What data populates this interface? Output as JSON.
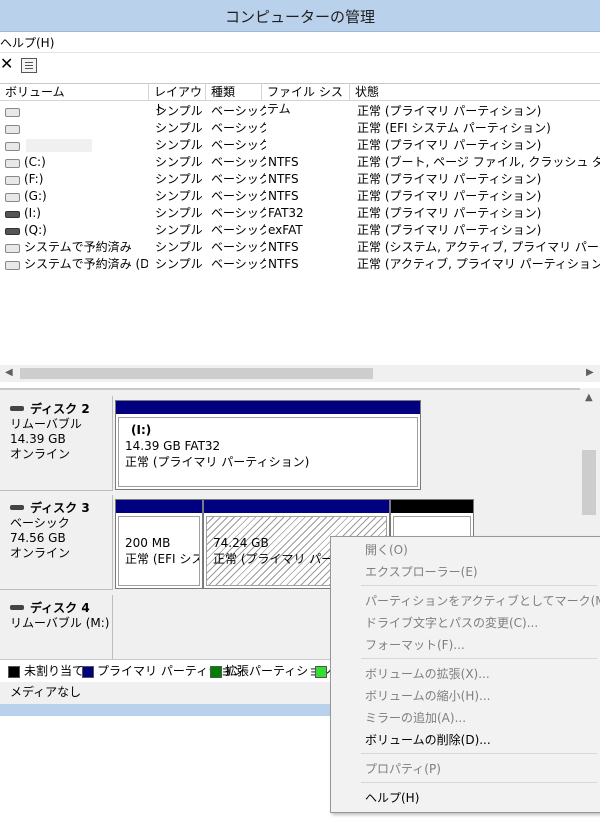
{
  "window": {
    "title": "コンピューターの管理"
  },
  "menubar": {
    "help": "ヘルプ(H)"
  },
  "toolbar": {
    "delete_glyph": "✕"
  },
  "table": {
    "headers": [
      "ボリューム",
      "レイアウト",
      "種類",
      "ファイル システム",
      "状態"
    ],
    "rows": [
      {
        "volume": "",
        "layout": "シンプル",
        "type": "ベーシック",
        "fs": "",
        "status": "正常 (プライマリ パーティション)"
      },
      {
        "volume": "",
        "layout": "シンプル",
        "type": "ベーシック",
        "fs": "",
        "status": "正常 (EFI システム パーティション)"
      },
      {
        "volume": "",
        "layout": "シンプル",
        "type": "ベーシック",
        "fs": "",
        "status": "正常 (プライマリ パーティション)"
      },
      {
        "volume": "(C:)",
        "layout": "シンプル",
        "type": "ベーシック",
        "fs": "NTFS",
        "status": "正常 (ブート, ページ ファイル, クラッシュ ダンプ, プラ"
      },
      {
        "volume": "(F:)",
        "layout": "シンプル",
        "type": "ベーシック",
        "fs": "NTFS",
        "status": "正常 (プライマリ パーティション)"
      },
      {
        "volume": "(G:)",
        "layout": "シンプル",
        "type": "ベーシック",
        "fs": "NTFS",
        "status": "正常 (プライマリ パーティション)"
      },
      {
        "volume": "(I:)",
        "layout": "シンプル",
        "type": "ベーシック",
        "fs": "FAT32",
        "status": "正常 (プライマリ パーティション)"
      },
      {
        "volume": "(Q:)",
        "layout": "シンプル",
        "type": "ベーシック",
        "fs": "exFAT",
        "status": "正常 (プライマリ パーティション)"
      },
      {
        "volume": "システムで予約済み",
        "layout": "シンプル",
        "type": "ベーシック",
        "fs": "NTFS",
        "status": "正常 (システム, アクティブ, プライマリ パーティション)"
      },
      {
        "volume": "システムで予約済み (D:)",
        "layout": "シンプル",
        "type": "ベーシック",
        "fs": "NTFS",
        "status": "正常 (アクティブ, プライマリ パーティション)"
      }
    ]
  },
  "disks": [
    {
      "name": "ディスク 2",
      "kind": "リムーバブル",
      "size": "14.39 GB",
      "state": "オンライン",
      "partitions": [
        {
          "label": "(I:)",
          "size": "14.39 GB FAT32",
          "status": "正常 (プライマリ パーティション)"
        }
      ]
    },
    {
      "name": "ディスク 3",
      "kind": "ベーシック",
      "size": "74.56 GB",
      "state": "オンライン",
      "partitions": [
        {
          "label": "",
          "size": "200 MB",
          "status": "正常 (EFI シス"
        },
        {
          "label": "",
          "size": "74.24 GB",
          "status": "正常 (プライマリ パーティ"
        },
        {
          "label": "",
          "size": "",
          "status": ""
        }
      ]
    },
    {
      "name": "ディスク 4",
      "kind": "リムーバブル (M:)",
      "size": "",
      "state": "メディアなし",
      "partitions": []
    }
  ],
  "legend": [
    {
      "label": "未割り当て",
      "color": "#000000"
    },
    {
      "label": "プライマリ パーティション",
      "color": "#000080"
    },
    {
      "label": "拡張パーティション",
      "color": "#008000"
    },
    {
      "label": "",
      "color": "#33dd33"
    }
  ],
  "context_menu": {
    "items": [
      {
        "label": "開く(O)",
        "enabled": false
      },
      {
        "label": "エクスプローラー(E)",
        "enabled": false
      },
      {
        "label": "パーティションをアクティブとしてマーク(M)",
        "enabled": false
      },
      {
        "label": "ドライブ文字とパスの変更(C)...",
        "enabled": false
      },
      {
        "label": "フォーマット(F)...",
        "enabled": false
      },
      {
        "label": "ボリュームの拡張(X)...",
        "enabled": false
      },
      {
        "label": "ボリュームの縮小(H)...",
        "enabled": false
      },
      {
        "label": "ミラーの追加(A)...",
        "enabled": false
      },
      {
        "label": "ボリュームの削除(D)...",
        "enabled": true
      },
      {
        "label": "プロパティ(P)",
        "enabled": false
      },
      {
        "label": "ヘルプ(H)",
        "enabled": true
      }
    ]
  }
}
